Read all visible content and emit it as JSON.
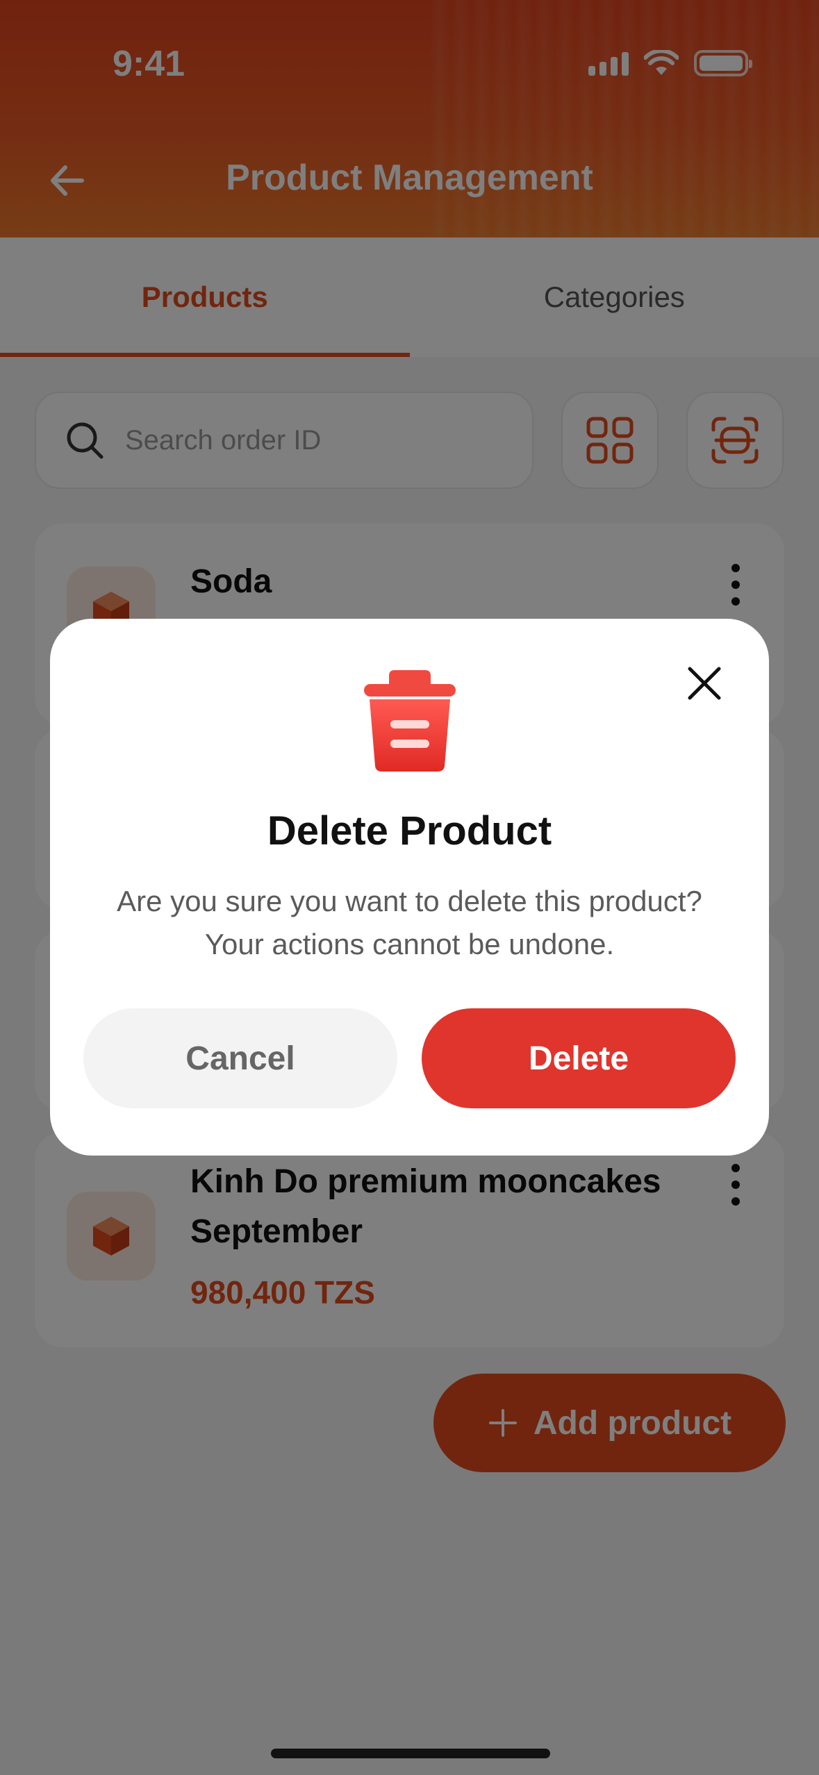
{
  "status_bar": {
    "time": "9:41"
  },
  "header": {
    "title": "Product Management"
  },
  "tabs": [
    {
      "label": "Products",
      "active": true
    },
    {
      "label": "Categories",
      "active": false
    }
  ],
  "search": {
    "placeholder": "Search order ID"
  },
  "products": [
    {
      "name": "Soda",
      "price": ""
    },
    {
      "name": "Kinh Do premium mooncakes September",
      "price": "980,400 TZS"
    }
  ],
  "add_button": {
    "label": "Add product"
  },
  "modal": {
    "title": "Delete Product",
    "message": "Are you sure you want to delete this product? Your actions cannot be undone.",
    "cancel_label": "Cancel",
    "delete_label": "Delete"
  },
  "colors": {
    "accent": "#e24a1c",
    "danger": "#e0352c",
    "overlay": "rgba(0,0,0,0.5)"
  },
  "icons": [
    "back-arrow-icon",
    "search-icon",
    "grid-view-icon",
    "scan-icon",
    "box-icon",
    "more-vertical-icon",
    "plus-icon",
    "close-icon",
    "trash-icon",
    "signal-icon",
    "wifi-icon",
    "battery-icon"
  ]
}
